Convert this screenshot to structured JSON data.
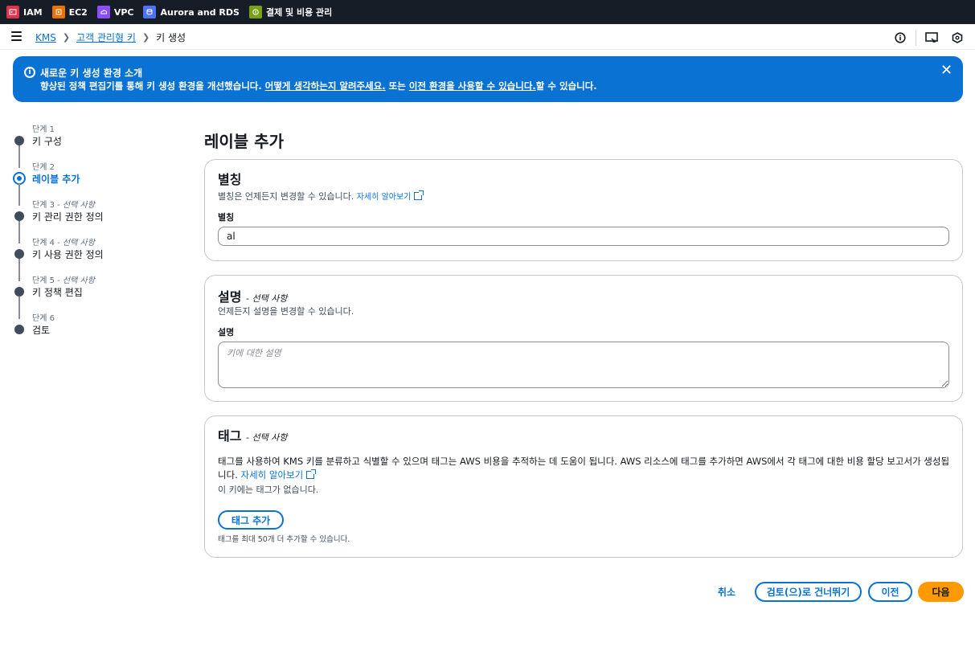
{
  "favorites": [
    {
      "label": "IAM",
      "color": "#dd344c",
      "icon": "iam-icon"
    },
    {
      "label": "EC2",
      "color": "#ed7100",
      "icon": "ec2-icon"
    },
    {
      "label": "VPC",
      "color": "#8c4fff",
      "icon": "vpc-icon"
    },
    {
      "label": "Aurora and RDS",
      "color": "#4d72f3",
      "icon": "rds-icon"
    },
    {
      "label": "결제 및 비용 관리",
      "color": "#7aa116",
      "icon": "billing-icon"
    }
  ],
  "breadcrumbs": {
    "root": "KMS",
    "parent": "고객 관리형 키",
    "current": "키 생성"
  },
  "flash": {
    "title": "새로운 키 생성 환경 소개",
    "text_before": "향상된 정책 편집기를 통해 키 생성 환경을 개선했습니다. ",
    "link_feedback": "어떻게 생각하는지 알려주세요.",
    "text_mid": " 또는 ",
    "link_previous": "이전 환경을 사용할 수 있습니다.",
    "text_after": "할 수 있습니다."
  },
  "steps": [
    {
      "number": "단계 1",
      "optional": "",
      "label": "키 구성",
      "active": false
    },
    {
      "number": "단계 2",
      "optional": "",
      "label": "레이블 추가",
      "active": true
    },
    {
      "number": "단계 3 - ",
      "optional": "선택 사항",
      "label": "키 관리 권한 정의",
      "active": false
    },
    {
      "number": "단계 4 - ",
      "optional": "선택 사항",
      "label": "키 사용 권한 정의",
      "active": false
    },
    {
      "number": "단계 5 - ",
      "optional": "선택 사항",
      "label": "키 정책 편집",
      "active": false
    },
    {
      "number": "단계 6",
      "optional": "",
      "label": "검토",
      "active": false
    }
  ],
  "page_title": "레이블 추가",
  "alias": {
    "title": "별칭",
    "description": "별칭은 언제든지 변경할 수 있습니다.",
    "learn_more": "자세히 알아보기",
    "field_label": "별칭",
    "value": "al"
  },
  "description_section": {
    "title": "설명",
    "optional": "- 선택 사항",
    "description": "언제든지 설명을 변경할 수 있습니다.",
    "field_label": "설명",
    "placeholder": "키에 대한 설명"
  },
  "tags": {
    "title": "태그",
    "optional": "- 선택 사항",
    "text": "태그를 사용하여 KMS 키를 분류하고 식별할 수 있으며 태그는 AWS 비용을 추적하는 데 도움이 됩니다. AWS 리소스에 태그를 추가하면 AWS에서 각 태그에 대한 비용 할당 보고서가 생성됩니다.",
    "learn_more": "자세히 알아보기",
    "empty": "이 키에는 태그가 없습니다.",
    "add_button": "태그 추가",
    "hint": "태그를 최대 50개 더 추가할 수 있습니다."
  },
  "footer": {
    "cancel": "취소",
    "skip": "검토(으)로 건너뛰기",
    "previous": "이전",
    "next": "다음"
  }
}
